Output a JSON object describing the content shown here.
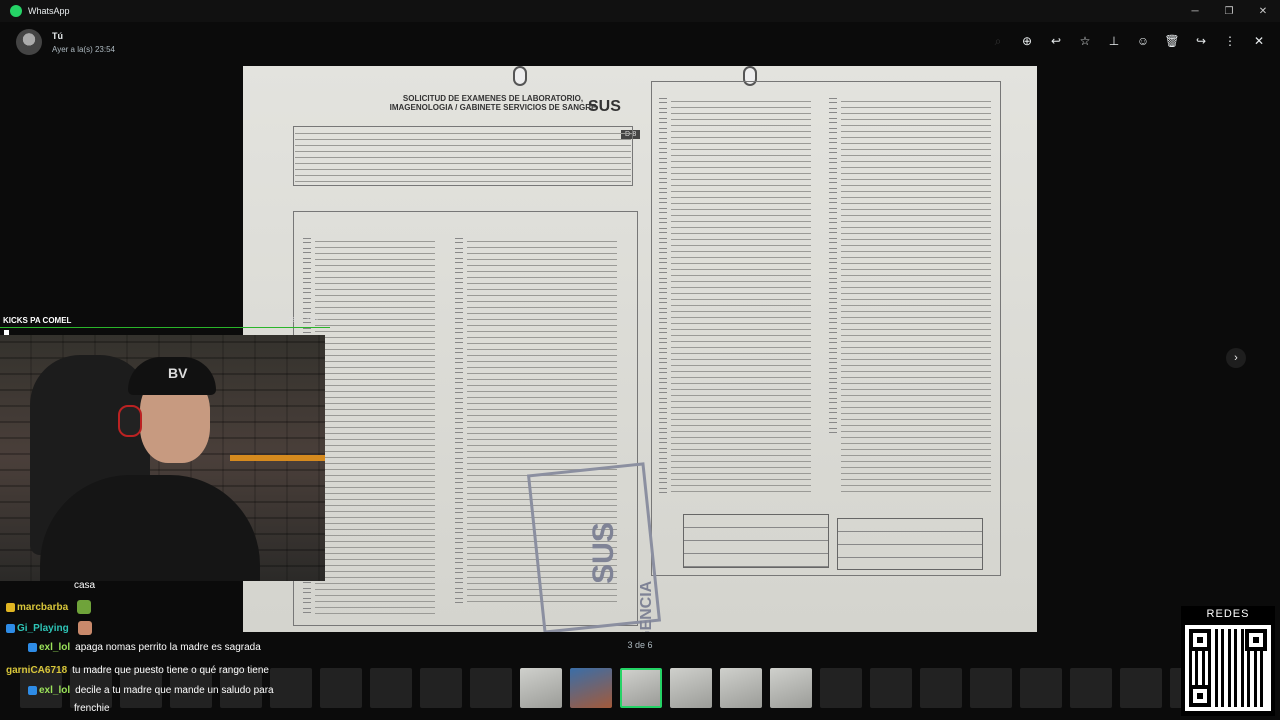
{
  "app": {
    "name": "WhatsApp"
  },
  "window_controls": {
    "minimize": "─",
    "restore": "❐",
    "close": "✕"
  },
  "header": {
    "sender": "Tú",
    "timestamp": "Ayer a la(s) 23:54",
    "tools": [
      {
        "name": "search-icon",
        "glyph": "⌕"
      },
      {
        "name": "zoom-icon",
        "glyph": "⊕"
      },
      {
        "name": "reply-icon",
        "glyph": "↩"
      },
      {
        "name": "star-icon",
        "glyph": "☆"
      },
      {
        "name": "pin-icon",
        "glyph": "⊥"
      },
      {
        "name": "emoji-icon",
        "glyph": "☺"
      },
      {
        "name": "delete-icon",
        "glyph": "🗑"
      },
      {
        "name": "forward-icon",
        "glyph": "↪"
      },
      {
        "name": "more-icon",
        "glyph": "⋮"
      },
      {
        "name": "close-icon",
        "glyph": "✕"
      }
    ]
  },
  "document": {
    "title": "SOLICITUD DE EXAMENES DE LABORATORIO, IMAGENOLOGIA / GABINETE SERVICIOS DE SANGRE",
    "brand": "SUS",
    "badge": "D-8",
    "stamp": "SUS",
    "stamp_sub": "EMERGENCIA"
  },
  "viewer": {
    "page_counter": "3 de 6",
    "next_glyph": "›"
  },
  "stream": {
    "title": "KICKS PA COMEL",
    "progress_current": "28",
    "progress_total": "100",
    "cap_logo": "BV"
  },
  "chat": [
    {
      "badge": "",
      "user": "",
      "message": "casa",
      "user_color": "#ffffff"
    },
    {
      "badge": "gold",
      "user": "marcbarba",
      "message": "",
      "user_color": "#d8c63a",
      "emote": "#6fa33a"
    },
    {
      "badge": "blue",
      "user": "Gi_Playing",
      "message": "",
      "user_color": "#2ec4b6",
      "emote": "#c9896b"
    },
    {
      "badge": "blue",
      "user": "exl_lol",
      "message": "apaga nomas perrito la madre es sagrada",
      "user_color": "#9be35a"
    },
    {
      "badge": "",
      "user": "garniCA6718",
      "message": "tu madre que puesto tiene o qué rango tiene",
      "user_color": "#d8c63a"
    },
    {
      "badge": "blue",
      "user": "exl_lol",
      "message": "decile a tu madre que mande un saludo para",
      "user_color": "#9be35a"
    },
    {
      "badge": "",
      "user": "",
      "message": "frenchie",
      "user_color": "#ffffff"
    }
  ],
  "overlay": {
    "qr_label": "REDES"
  },
  "colors": {
    "accent": "#25d366",
    "background": "#0b0b0b"
  },
  "thumbnails": {
    "active_index": 12,
    "count": 24
  }
}
